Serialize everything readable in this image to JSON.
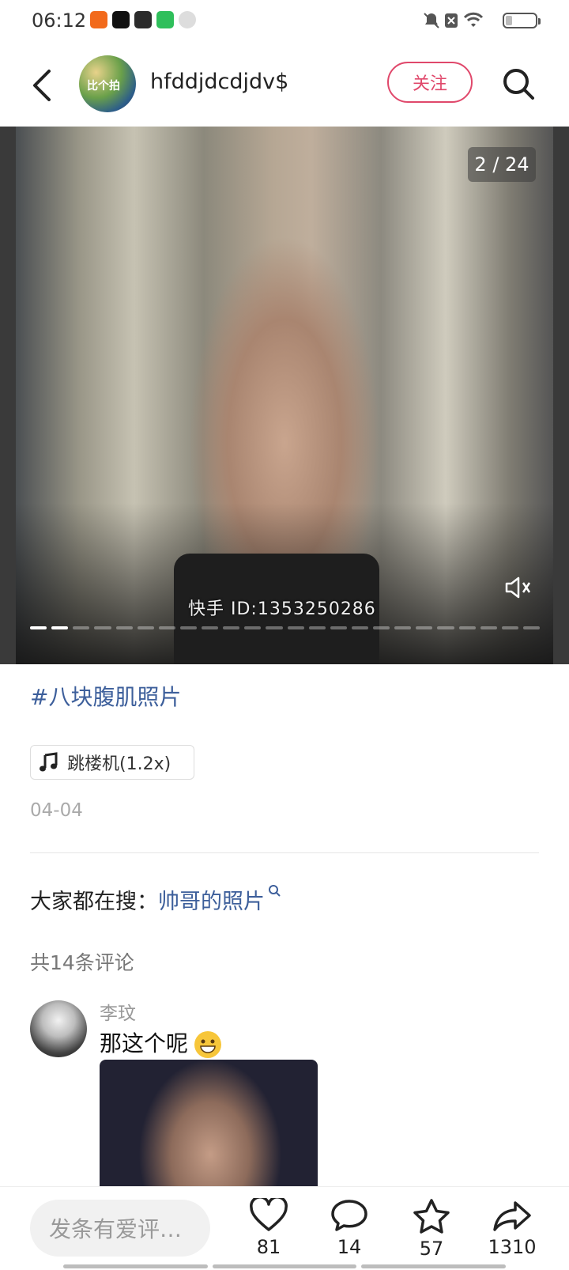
{
  "status_bar": {
    "time": "06:12",
    "apps": [
      "kuaishou-icon",
      "douyin-icon",
      "gallery-icon",
      "iqiyi-icon",
      "link-icon"
    ]
  },
  "header": {
    "username": "hfddjdcdjdv$",
    "avatar_text": "比个拍",
    "follow_label": "关注"
  },
  "photo": {
    "counter": "2 / 24",
    "watermark": "快手 ID:1353250286",
    "current_index": 2,
    "total_segments": 24
  },
  "post": {
    "hashtag": "#八块腹肌照片",
    "music": "跳楼机(1.2x)",
    "date": "04-04",
    "search_prefix": "大家都在搜：",
    "search_keyword": "帅哥的照片"
  },
  "comments": {
    "count_label": "共14条评论",
    "items": [
      {
        "name": "李玟",
        "text": "那这个呢"
      }
    ]
  },
  "bottom_bar": {
    "placeholder": "发条有爱评…",
    "likes": "81",
    "comments": "14",
    "favorites": "57",
    "shares": "1310"
  },
  "colors": {
    "accent": "#e0486b",
    "link": "#3d5f9b"
  }
}
